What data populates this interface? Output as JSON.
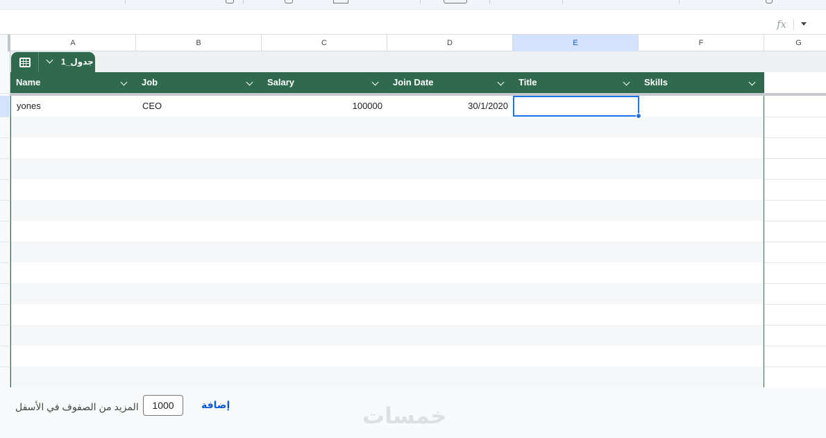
{
  "columns": [
    "A",
    "B",
    "C",
    "D",
    "E",
    "F",
    "G"
  ],
  "active_column": "E",
  "formula_bar": {
    "fx_label": "fx"
  },
  "table": {
    "name": "جدول_1",
    "headers": [
      "Name",
      "Job",
      "Salary",
      "Join Date",
      "Title",
      "Skills"
    ],
    "rows": [
      [
        "yones",
        "CEO",
        "100000",
        "30/1/2020",
        "",
        ""
      ]
    ],
    "header_color": "#2f6a4f"
  },
  "footer": {
    "add_label": "إضافة",
    "row_count": "1000",
    "more_rows_label": "المزيد من الصفوف في الأسفل"
  },
  "watermark": "خمسات",
  "colors": {
    "accent": "#1a73e8",
    "table_green": "#2f6a4f",
    "active_col_bg": "#d3e3fd"
  }
}
